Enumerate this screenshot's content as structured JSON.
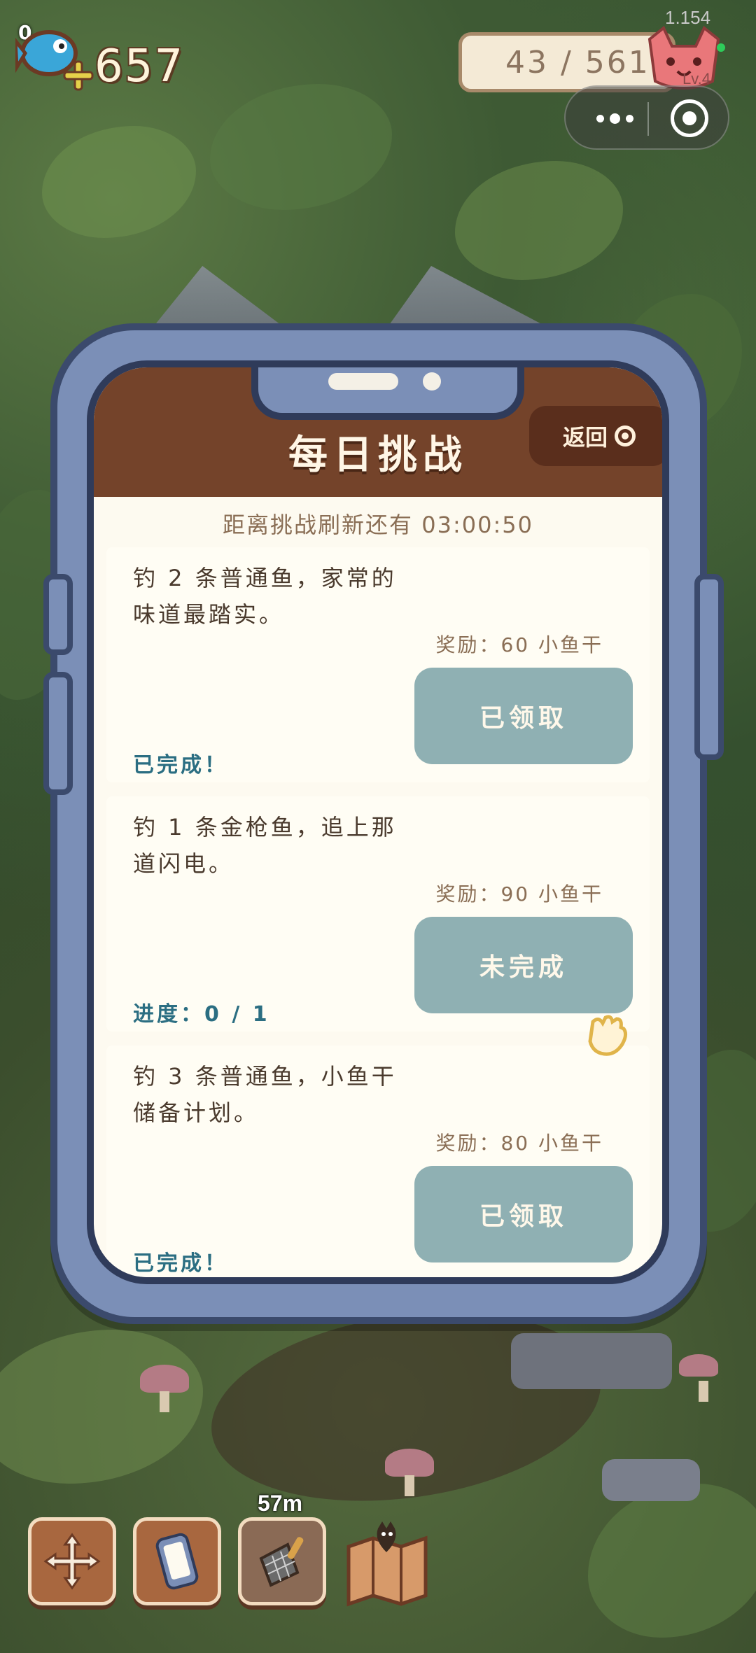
{
  "hud": {
    "zero_badge": "0",
    "coins": "657",
    "version": "1.154",
    "xp": "43 / 561",
    "cat_level": "Lv.4"
  },
  "panel": {
    "title": "每日挑战",
    "back_label": "返回",
    "refresh_text": "距离挑战刷新还有 03:00:50"
  },
  "challenges": [
    {
      "desc": "钓 2 条普通鱼，家常的味道最踏实。",
      "reward": "奖励：60 小鱼干",
      "button": "已领取",
      "status": "已完成！"
    },
    {
      "desc": "钓 1 条金枪鱼，追上那道闪电。",
      "reward": "奖励：90 小鱼干",
      "button": "未完成",
      "status": "进度：0 / 1"
    },
    {
      "desc": "钓 3 条普通鱼，小鱼干储备计划。",
      "reward": "奖励：80 小鱼干",
      "button": "已领取",
      "status": "已完成！"
    }
  ],
  "toolbar": {
    "timer": "57m",
    "icons": [
      "move-arrows-icon",
      "phone-icon",
      "fishing-net-icon",
      "cat-map-icon"
    ]
  },
  "colors": {
    "header_brown": "#74432a",
    "button_teal": "#8fb0b3",
    "status_blue": "#2b6e82",
    "frame_blue": "#7b8fb7"
  }
}
